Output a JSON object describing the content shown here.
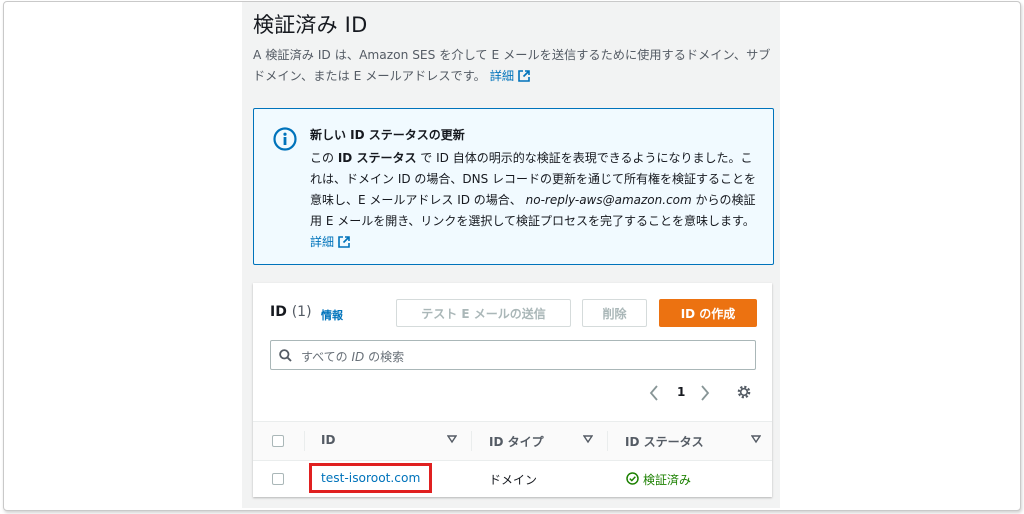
{
  "header": {
    "title": "検証済み ID",
    "description": "A 検証済み ID は、Amazon SES を介して E メールを送信するために使用するドメイン、サブドメイン、または E メールアドレスです。",
    "learn_more": "詳細"
  },
  "flash": {
    "icon": "info-icon",
    "title": "新しい ID ステータスの更新",
    "body_1": "この",
    "body_bold": "ID ステータス",
    "body_2": "で ID 自体の明示的な検証を表現できるようになりました。これは、ドメイン ID の場合、DNS レコードの更新を通じて所有権を検証することを意味し、E メールアドレス ID の場合、",
    "body_email": "no-reply-aws@amazon.com",
    "body_3": "からの検証用 E メールを開き、リンクを選択して検証プロセスを完了することを意味します。",
    "learn_more": "詳細"
  },
  "panel": {
    "title": "ID",
    "count": "(1)",
    "info": "情報",
    "send_test_email": "テスト E メールの送信",
    "delete": "削除",
    "create_identity": "ID の作成",
    "search_placeholder_pre": "すべての",
    "search_placeholder_em": "ID",
    "search_placeholder_post": "の検索",
    "page": "1"
  },
  "table": {
    "columns": [
      "ID",
      "ID タイプ",
      "ID ステータス"
    ],
    "rows": [
      {
        "id": "test-isoroot.com",
        "type": "ドメイン",
        "status": "検証済み"
      }
    ]
  },
  "colors": {
    "accent": "#0073bb",
    "primary_button": "#ec7211",
    "success": "#1d8102",
    "highlight": "#e02020"
  }
}
